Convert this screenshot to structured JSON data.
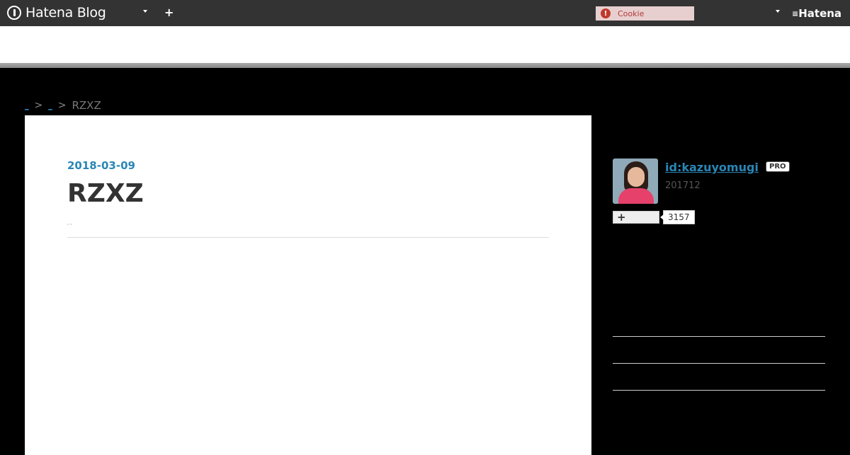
{
  "topbar": {
    "brand": "Hatena Blog",
    "add_label": "+",
    "cookie_alert_glyph": "!",
    "cookie_label": "Cookie",
    "hatena_label": "Hatena"
  },
  "breadcrumb": {
    "link_1": "_",
    "link_2": "_",
    "separator": ">",
    "current": "RZXZ"
  },
  "article": {
    "date": "2018-03-09",
    "title": "RZXZ",
    "tags": "' '"
  },
  "profile": {
    "id": "id:kazuyomugi",
    "badge": "PRO",
    "since": "201712",
    "subscribe_label": "+",
    "subscriber_count": "3157"
  },
  "colors": {
    "topbar": "#333333",
    "link": "#2a86b5",
    "background": "#000000"
  }
}
